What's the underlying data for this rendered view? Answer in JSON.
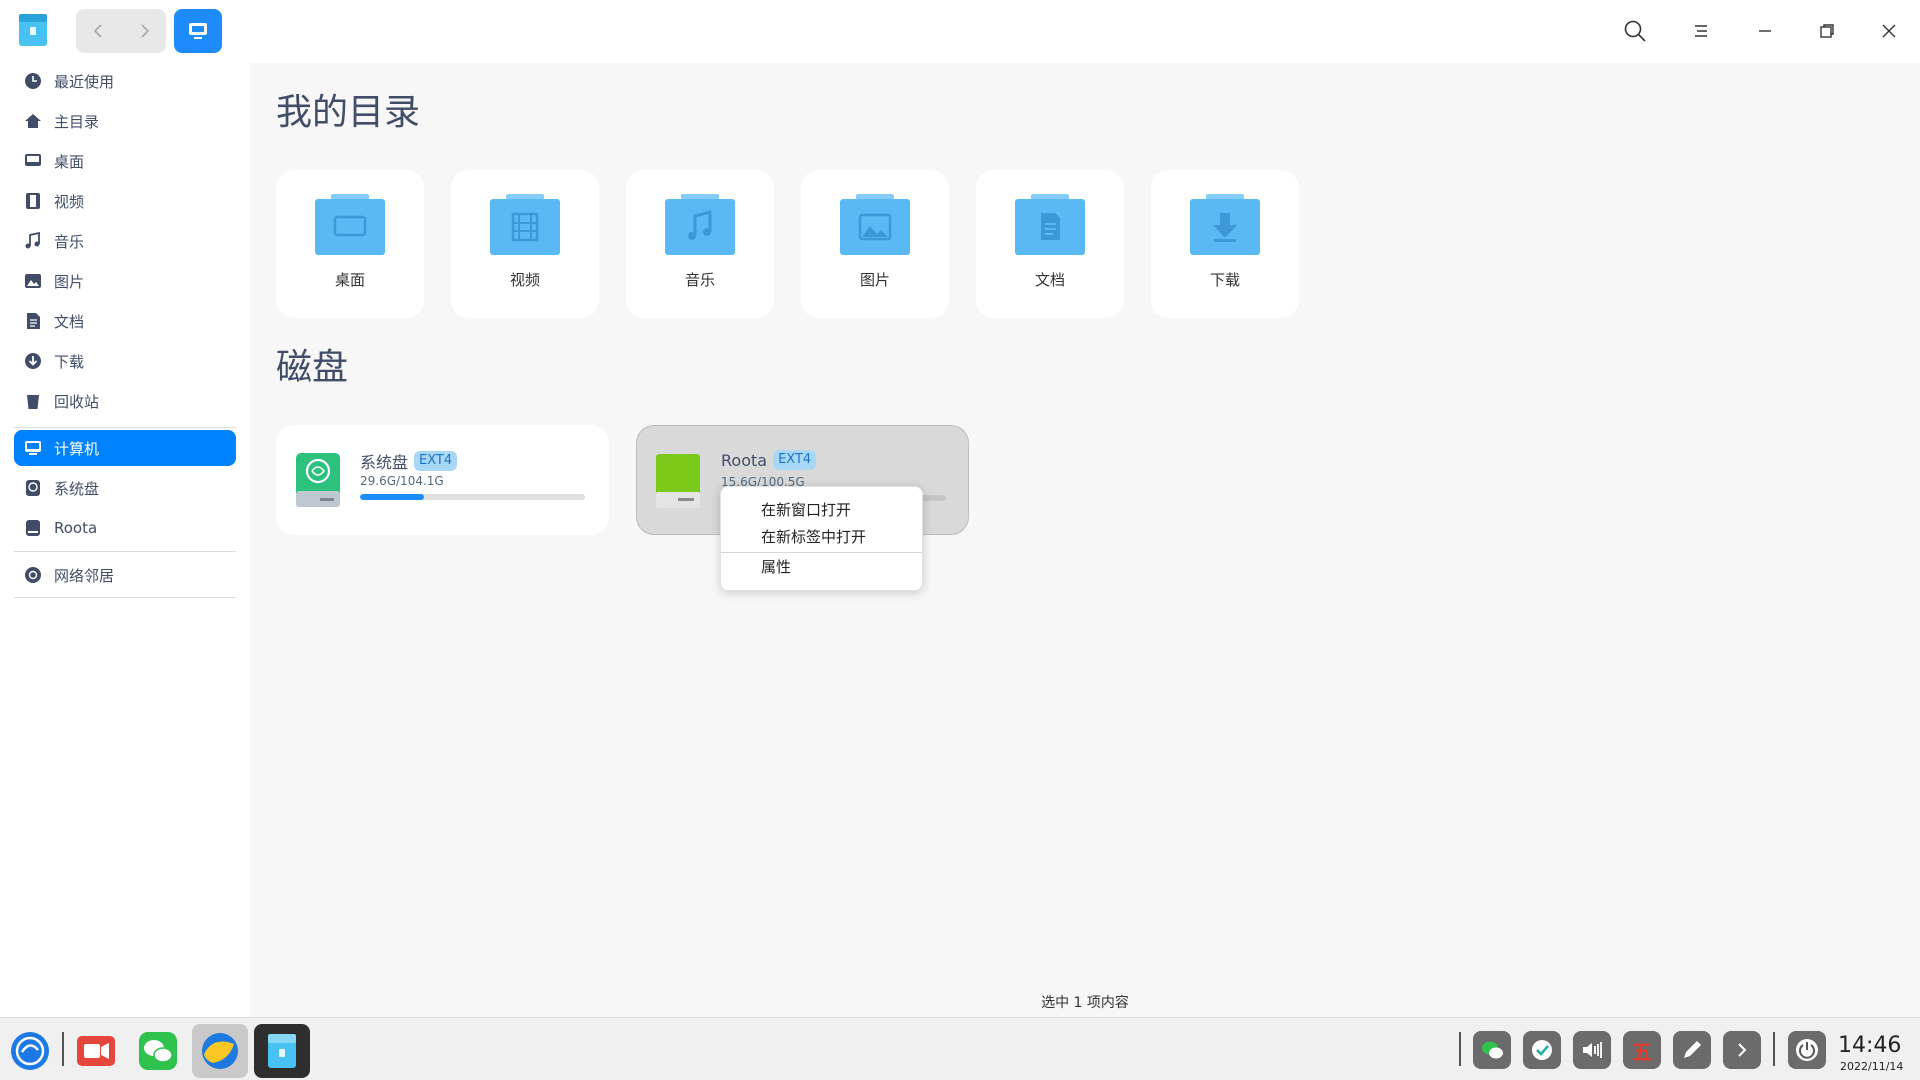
{
  "titlebar": {
    "icons": [
      "file-manager-logo",
      "back-icon",
      "forward-icon",
      "computer-view-icon",
      "search-icon",
      "menu-icon",
      "minimize-icon",
      "restore-icon",
      "close-icon"
    ]
  },
  "sidebar": {
    "items": [
      {
        "label": "最近使用",
        "icon": "clock-icon"
      },
      {
        "label": "主目录",
        "icon": "home-icon"
      },
      {
        "label": "桌面",
        "icon": "desktop-icon"
      },
      {
        "label": "视频",
        "icon": "film-icon"
      },
      {
        "label": "音乐",
        "icon": "music-icon"
      },
      {
        "label": "图片",
        "icon": "picture-icon"
      },
      {
        "label": "文档",
        "icon": "document-icon"
      },
      {
        "label": "下载",
        "icon": "download-icon"
      },
      {
        "label": "回收站",
        "icon": "trash-icon"
      },
      {
        "label": "计算机",
        "icon": "computer-icon",
        "active": true
      },
      {
        "label": "系统盘",
        "icon": "deepin-disk-icon"
      },
      {
        "label": "Roota",
        "icon": "drive-icon"
      },
      {
        "label": "网络邻居",
        "icon": "network-icon"
      }
    ]
  },
  "main": {
    "my_dirs_title": "我的目录",
    "dirs": [
      {
        "label": "桌面",
        "icon": "desktop-folder-icon"
      },
      {
        "label": "视频",
        "icon": "video-folder-icon"
      },
      {
        "label": "音乐",
        "icon": "music-folder-icon"
      },
      {
        "label": "图片",
        "icon": "picture-folder-icon"
      },
      {
        "label": "文档",
        "icon": "document-folder-icon"
      },
      {
        "label": "下载",
        "icon": "download-folder-icon"
      }
    ],
    "disks_title": "磁盘",
    "disks": [
      {
        "name": "系统盘",
        "fs": "EXT4",
        "size": "29.6G/104.1G",
        "usage": 0.284
      },
      {
        "name": "Roota",
        "fs": "EXT4",
        "size": "15.6G/100.5G",
        "usage": 0.155
      }
    ],
    "status": "选中 1 项内容"
  },
  "context_menu": {
    "items": [
      "在新窗口打开",
      "在新标签中打开",
      "属性"
    ]
  },
  "dock": {
    "apps": [
      "launcher-icon",
      "screen-recorder-icon",
      "wechat-icon",
      "browser-icon",
      "file-manager-icon"
    ],
    "tray": [
      "wechat-tray-icon",
      "deepin-tray-icon",
      "volume-icon",
      "input-method-icon",
      "pen-icon",
      "expand-icon",
      "power-icon"
    ],
    "input_method_label": "五",
    "time": "14:46",
    "date": "2022/11/14"
  },
  "colors": {
    "accent": "#0081ff",
    "folder_blue": "#5ab9f5",
    "badge_bg": "#a9d8f7"
  }
}
